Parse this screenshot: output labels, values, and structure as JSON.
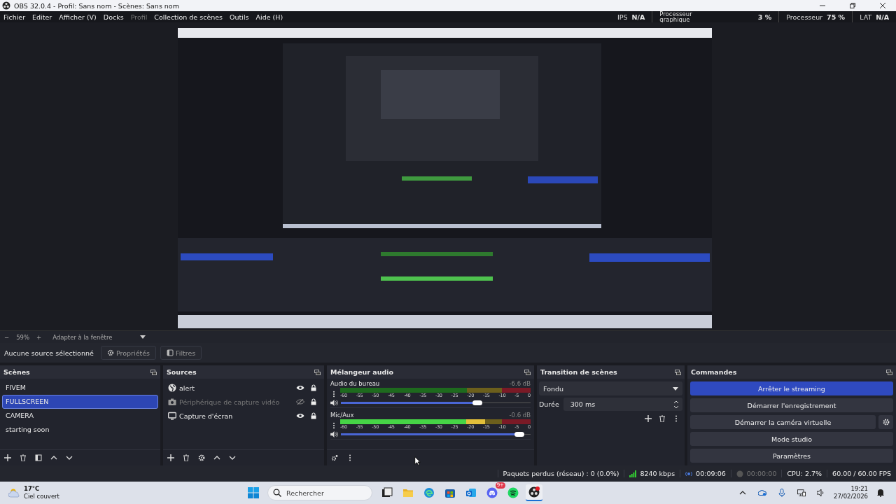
{
  "window": {
    "title": "OBS 32.0.4 - Profil: Sans nom - Scènes: Sans nom"
  },
  "menu": [
    {
      "label": "Fichier",
      "disabled": false
    },
    {
      "label": "Editer",
      "disabled": false
    },
    {
      "label": "Afficher (V)",
      "disabled": false
    },
    {
      "label": "Docks",
      "disabled": false
    },
    {
      "label": "Profil",
      "disabled": true
    },
    {
      "label": "Collection de scènes",
      "disabled": false
    },
    {
      "label": "Outils",
      "disabled": false
    },
    {
      "label": "Aide (H)",
      "disabled": false
    }
  ],
  "stats": [
    {
      "label": "IPS",
      "value": "N/A"
    },
    {
      "label": "Processeur graphique",
      "value": "3 %"
    },
    {
      "label": "Processeur",
      "value": "75 %"
    },
    {
      "label": "LAT",
      "value": "N/A"
    }
  ],
  "zoom_bar": {
    "minus": "−",
    "zoom": "59%",
    "plus": "+",
    "fit": "Adapter à la fenêtre"
  },
  "source_toolbar": {
    "label": "Aucune source sélectionné",
    "properties": "Propriétés",
    "filters": "Filtres"
  },
  "scenes": {
    "title": "Scènes",
    "items": [
      {
        "name": "FIVEM",
        "selected": false
      },
      {
        "name": "FULLSCREEN",
        "selected": true
      },
      {
        "name": "CAMERA",
        "selected": false
      },
      {
        "name": "starting soon",
        "selected": false
      }
    ]
  },
  "sources": {
    "title": "Sources",
    "items": [
      {
        "name": "alert",
        "kind": "browser",
        "visible": true
      },
      {
        "name": "Périphérique de capture vidéo",
        "kind": "camera",
        "visible": false
      },
      {
        "name": "Capture d'écran",
        "kind": "display",
        "visible": true
      }
    ]
  },
  "mixer": {
    "title": "Mélangeur audio",
    "channels": [
      {
        "name": "Audio du bureau",
        "reading": "-6.6 dB",
        "meter": {
          "level": 0
        },
        "fader": {
          "level": 0.72
        },
        "ticks": [
          "-60",
          "-55",
          "-50",
          "-45",
          "-40",
          "-35",
          "-30",
          "-25",
          "-20",
          "-15",
          "-10",
          "-5",
          "0"
        ]
      },
      {
        "name": "Mic/Aux",
        "reading": "-0.6 dB",
        "meter": {
          "level": 0.76
        },
        "fader": {
          "level": 0.94
        },
        "ticks": [
          "-60",
          "-55",
          "-50",
          "-45",
          "-40",
          "-35",
          "-30",
          "-25",
          "-20",
          "-15",
          "-10",
          "-5",
          "0"
        ]
      }
    ]
  },
  "transition": {
    "title": "Transition de scènes",
    "type": "Fondu",
    "duration_label": "Durée",
    "duration": "300 ms"
  },
  "controls": {
    "title": "Commandes",
    "buttons": [
      {
        "label": "Arrêter le streaming",
        "active": true,
        "settings": false
      },
      {
        "label": "Démarrer l'enregistrement",
        "active": false,
        "settings": false
      },
      {
        "label": "Démarrer la caméra virtuelle",
        "active": false,
        "settings": true
      },
      {
        "label": "Mode studio",
        "active": false,
        "settings": false
      },
      {
        "label": "Paramètres",
        "active": false,
        "settings": false
      }
    ]
  },
  "status_bar": {
    "dropped": "Paquets perdus (réseau) : 0 (0.0%)",
    "bitrate": "8240 kbps",
    "stream_time": "00:09:06",
    "record_time": "00:00:00",
    "cpu": "CPU: 2.7%",
    "fps": "60.00 / 60.00 FPS"
  },
  "taskbar": {
    "temperature": "17°C",
    "weather": "Ciel couvert",
    "search": {
      "placeholder": "Rechercher"
    },
    "apps": [
      {
        "kind": "taskview",
        "selected": false
      },
      {
        "kind": "files",
        "selected": false
      },
      {
        "kind": "edge",
        "selected": false
      },
      {
        "kind": "store",
        "selected": false
      },
      {
        "kind": "mail",
        "selected": false
      },
      {
        "kind": "discord",
        "selected": false,
        "badge": "9+"
      },
      {
        "kind": "spotify",
        "selected": false
      },
      {
        "kind": "obs",
        "selected": true
      }
    ],
    "time": "19:21",
    "date": "27/02/2026"
  }
}
